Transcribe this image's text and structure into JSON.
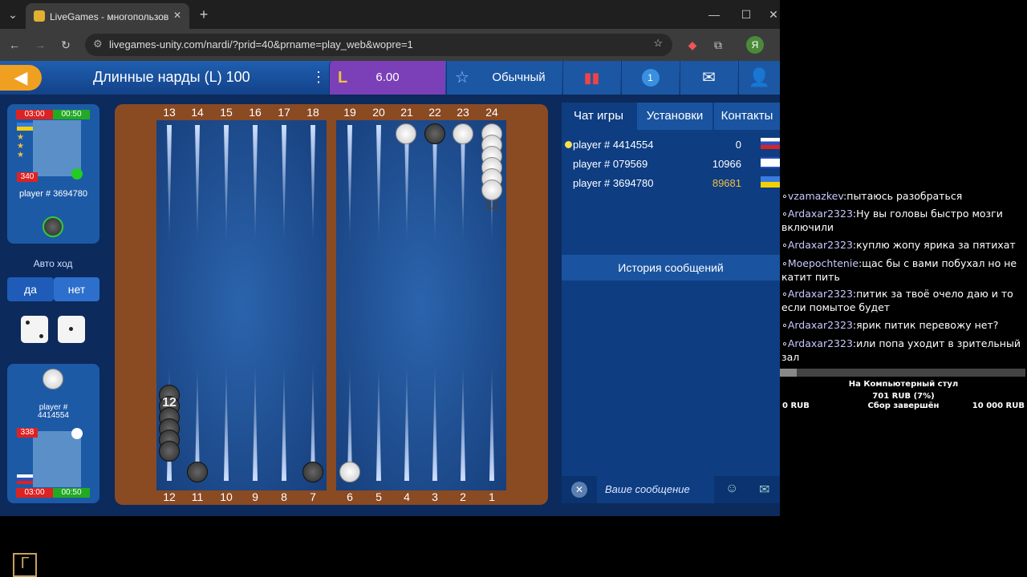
{
  "browser": {
    "tab_title": "LiveGames - многопользов",
    "url": "livegames-unity.com/nardi/?prid=40&prname=play_web&wopre=1",
    "profile_letter": "Я"
  },
  "nav": {
    "title": "Длинные нарды (L) 100",
    "rating": "6.00",
    "mode": "Обычный",
    "badge": "1"
  },
  "left": {
    "top_player": {
      "time1": "03:00",
      "time2": "00:50",
      "rating": "340",
      "name": "player # 3694780"
    },
    "auto_label": "Авто ход",
    "yes": "да",
    "no": "нет",
    "bottom_player": {
      "name": "player #\n4414554",
      "rating": "338",
      "time1": "03:00",
      "time2": "00:50"
    }
  },
  "board": {
    "top_points": [
      "13",
      "14",
      "15",
      "16",
      "17",
      "18",
      "19",
      "20",
      "21",
      "22",
      "23",
      "24"
    ],
    "bottom_points": [
      "12",
      "11",
      "10",
      "9",
      "8",
      "7",
      "6",
      "5",
      "4",
      "3",
      "2",
      "1"
    ],
    "stack_top": "12",
    "stack_bottom": "12"
  },
  "chat": {
    "tabs": [
      "Чат игры",
      "Установки",
      "Контакты"
    ],
    "players": [
      {
        "name": "player # 4414554",
        "score": "0"
      },
      {
        "name": "player # 079569",
        "score": "10966"
      },
      {
        "name": "player # 3694780",
        "score": "89681"
      }
    ],
    "history": "История сообщений",
    "placeholder": "Ваше сообщение"
  },
  "stream": {
    "messages": [
      {
        "user": "vzamazkev",
        "text": "пытаюсь разобраться"
      },
      {
        "user": "Ardaxar2323",
        "text": "Ну вы головы быстро мозги включили"
      },
      {
        "user": "Ardaxar2323",
        "text": "куплю жопу ярика за пятихат"
      },
      {
        "user": "Moepochtenie",
        "text": "щас бы с вами побухал но не катит пить"
      },
      {
        "user": "Ardaxar2323",
        "text": "питик за твоё очело даю и то если помытое будет"
      },
      {
        "user": "Ardaxar2323",
        "text": "ярик питик перевожу нет?"
      },
      {
        "user": "Ardaxar2323",
        "text": "или попа уходит в зрительный зал"
      }
    ],
    "goal_title": "На Компьютерный стул",
    "goal_amount": "701 RUB (7%)",
    "goal_min": "0 RUB",
    "goal_status": "Сбор завершён",
    "goal_max": "10 000 RUB"
  },
  "colors": {
    "accent": "#f0a020",
    "nav": "#1c57a4",
    "rating_bg": "#7b3fb8"
  }
}
